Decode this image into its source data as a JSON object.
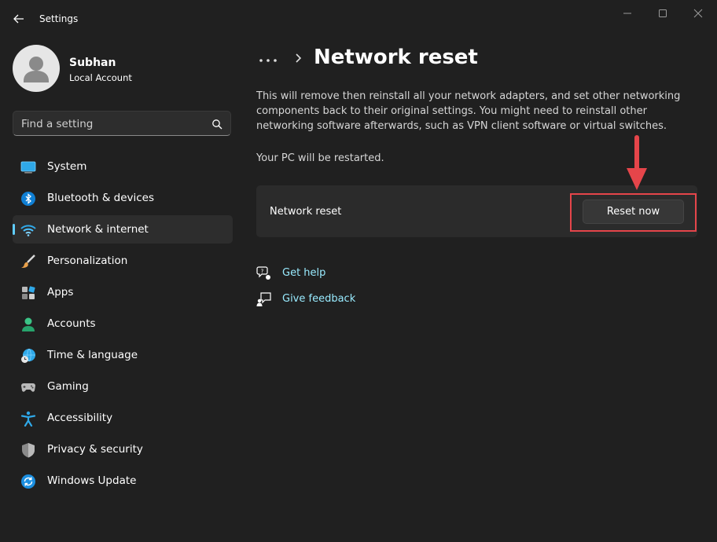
{
  "window": {
    "title": "Settings",
    "controls": {
      "minimize": "minimize-icon",
      "maximize": "maximize-icon",
      "close": "close-icon"
    }
  },
  "user": {
    "name": "Subhan",
    "account_type": "Local Account"
  },
  "search": {
    "placeholder": "Find a setting"
  },
  "sidebar": {
    "items": [
      {
        "label": "System",
        "icon": "system-display-icon"
      },
      {
        "label": "Bluetooth & devices",
        "icon": "bluetooth-icon"
      },
      {
        "label": "Network & internet",
        "icon": "wifi-icon",
        "active": true
      },
      {
        "label": "Personalization",
        "icon": "paintbrush-icon"
      },
      {
        "label": "Apps",
        "icon": "apps-icon"
      },
      {
        "label": "Accounts",
        "icon": "accounts-icon"
      },
      {
        "label": "Time & language",
        "icon": "globe-clock-icon"
      },
      {
        "label": "Gaming",
        "icon": "gamepad-icon"
      },
      {
        "label": "Accessibility",
        "icon": "accessibility-icon"
      },
      {
        "label": "Privacy & security",
        "icon": "shield-icon"
      },
      {
        "label": "Windows Update",
        "icon": "update-icon"
      }
    ]
  },
  "header": {
    "breadcrumb_more": "...",
    "title": "Network reset"
  },
  "content": {
    "description": "This will remove then reinstall all your network adapters, and set other networking components back to their original settings. You might need to reinstall other networking software afterwards, such as VPN client software or virtual switches.",
    "restart_note": "Your PC will be restarted.",
    "card": {
      "label": "Network reset",
      "button_label": "Reset now"
    },
    "links": [
      {
        "label": "Get help",
        "icon": "help-chat-icon"
      },
      {
        "label": "Give feedback",
        "icon": "feedback-icon"
      }
    ]
  },
  "colors": {
    "background": "#202020",
    "accent": "#60cdff",
    "link": "#99ebff",
    "annotation": "#e5454a"
  }
}
